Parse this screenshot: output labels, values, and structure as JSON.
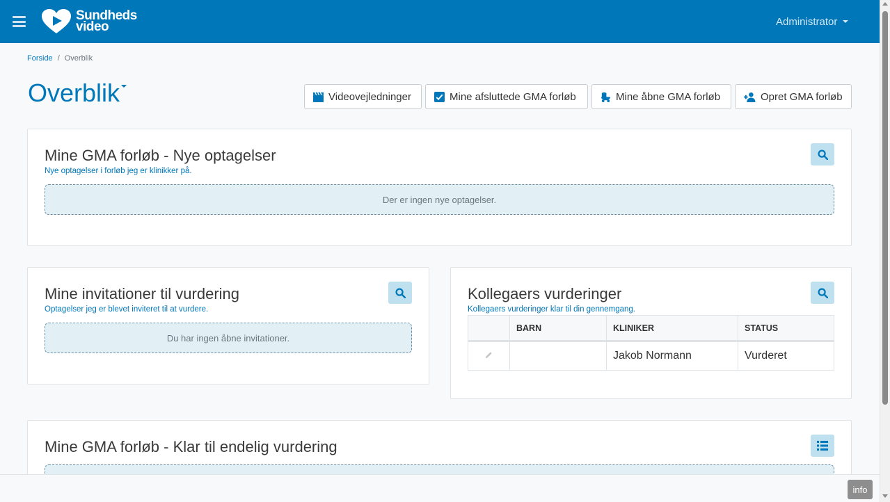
{
  "header": {
    "logo_line1": "Sundheds",
    "logo_line2": "video",
    "user_menu": "Administrator"
  },
  "breadcrumb": {
    "home": "Forside",
    "separator": "/",
    "current": "Overblik"
  },
  "page": {
    "title": "Overblik"
  },
  "toolbar": {
    "videos": "Videovejledninger",
    "finished": "Mine afsluttede GMA forløb",
    "open": "Mine åbne GMA forløb",
    "create": "Opret GMA forløb"
  },
  "cards": {
    "new_recordings": {
      "title": "Mine GMA forløb - Nye optagelser",
      "subtitle": "Nye optagelser i forløb jeg er klinikker på.",
      "empty": "Der er ingen nye optagelser."
    },
    "invitations": {
      "title": "Mine invitationer til vurdering",
      "subtitle": "Optagelser jeg er blevet inviteret til at vurdere.",
      "empty": "Du har ingen åbne invitationer."
    },
    "colleagues": {
      "title": "Kollegaers vurderinger",
      "subtitle": "Kollegaers vurderinger klar til din gennemgang.",
      "columns": [
        "",
        "BARN",
        "KLINIKER",
        "STATUS"
      ],
      "rows": [
        {
          "child": "",
          "clinician": "Jakob Normann",
          "status": "Vurderet"
        }
      ]
    },
    "final": {
      "title": "Mine GMA forløb - Klar til endelig vurdering"
    }
  },
  "footer": {
    "info": "info"
  },
  "colors": {
    "primary": "#0077b9",
    "search_button_bg": "#bfe0ef",
    "empty_bg": "#e2f0f6"
  }
}
